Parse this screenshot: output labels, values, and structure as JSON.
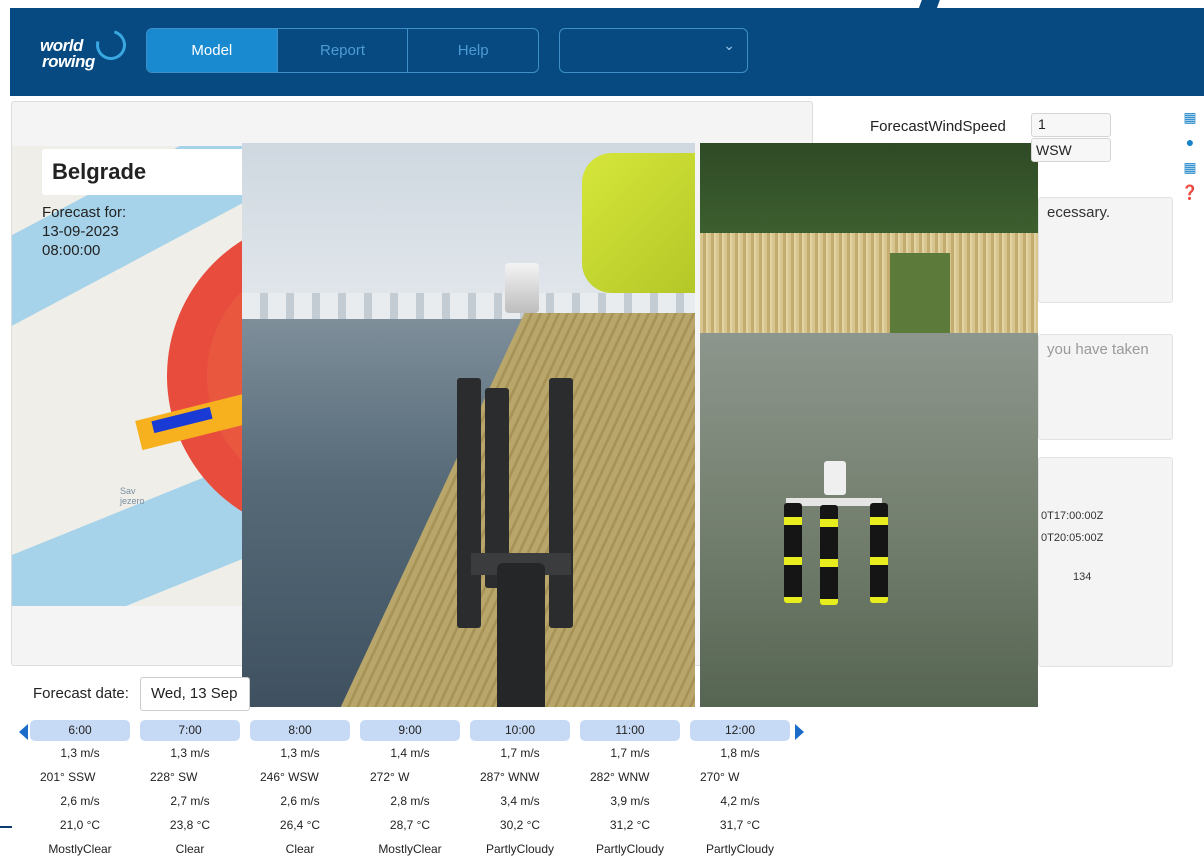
{
  "header": {
    "logo_line1": "world",
    "logo_line2": "rowing",
    "tabs": [
      {
        "label": "Model",
        "active": true
      },
      {
        "label": "Report",
        "active": false
      },
      {
        "label": "Help",
        "active": false
      }
    ],
    "venue_select_value": ""
  },
  "map": {
    "venue_name": "Belgrade",
    "forecast_for_label": "Forecast for:",
    "forecast_date": "13-09-2023",
    "forecast_time": "08:00:00",
    "lake_label_1": "Sav",
    "lake_label_2": "jezero"
  },
  "right_panel": {
    "forecast_wind_speed_label": "ForecastWindSpeed",
    "forecast_wind_speed_value": "1",
    "wind_direction_value": "WSW",
    "note_text": "ecessary.",
    "action_placeholder": "you have taken",
    "info_line_1": "0T17:00:00Z",
    "info_line_2": "0T20:05:00Z",
    "info_line_3": "134"
  },
  "side_icons": [
    "id-card-icon",
    "globe-icon",
    "grid-icon",
    "help-icon"
  ],
  "forecast_date": {
    "label": "Forecast date:",
    "value": "Wed, 13 Sep"
  },
  "hourly": [
    {
      "time": "6:00",
      "wind": "1,3 m/s",
      "dir": "201°  SSW",
      "gust": "2,6 m/s",
      "temp": "21,0 °C",
      "cond": "MostlyClear"
    },
    {
      "time": "7:00",
      "wind": "1,3 m/s",
      "dir": "228°  SW",
      "gust": "2,7 m/s",
      "temp": "23,8 °C",
      "cond": "Clear"
    },
    {
      "time": "8:00",
      "wind": "1,3 m/s",
      "dir": "246°  WSW",
      "gust": "2,6 m/s",
      "temp": "26,4 °C",
      "cond": "Clear"
    },
    {
      "time": "9:00",
      "wind": "1,4 m/s",
      "dir": "272°  W",
      "gust": "2,8 m/s",
      "temp": "28,7 °C",
      "cond": "MostlyClear"
    },
    {
      "time": "10:00",
      "wind": "1,7 m/s",
      "dir": "287°  WNW",
      "gust": "3,4 m/s",
      "temp": "30,2 °C",
      "cond": "PartlyCloudy"
    },
    {
      "time": "11:00",
      "wind": "1,7 m/s",
      "dir": "282°  WNW",
      "gust": "3,9 m/s",
      "temp": "31,2 °C",
      "cond": "PartlyCloudy"
    },
    {
      "time": "12:00",
      "wind": "1,8 m/s",
      "dir": "270°  W",
      "gust": "4,2 m/s",
      "temp": "31,7 °C",
      "cond": "PartlyCloudy"
    }
  ],
  "colors": {
    "header_bg": "#074a82",
    "active_tab": "#1a8ad0",
    "time_chip": "#c7daf5",
    "nav_arrow": "#1a6cc8"
  }
}
